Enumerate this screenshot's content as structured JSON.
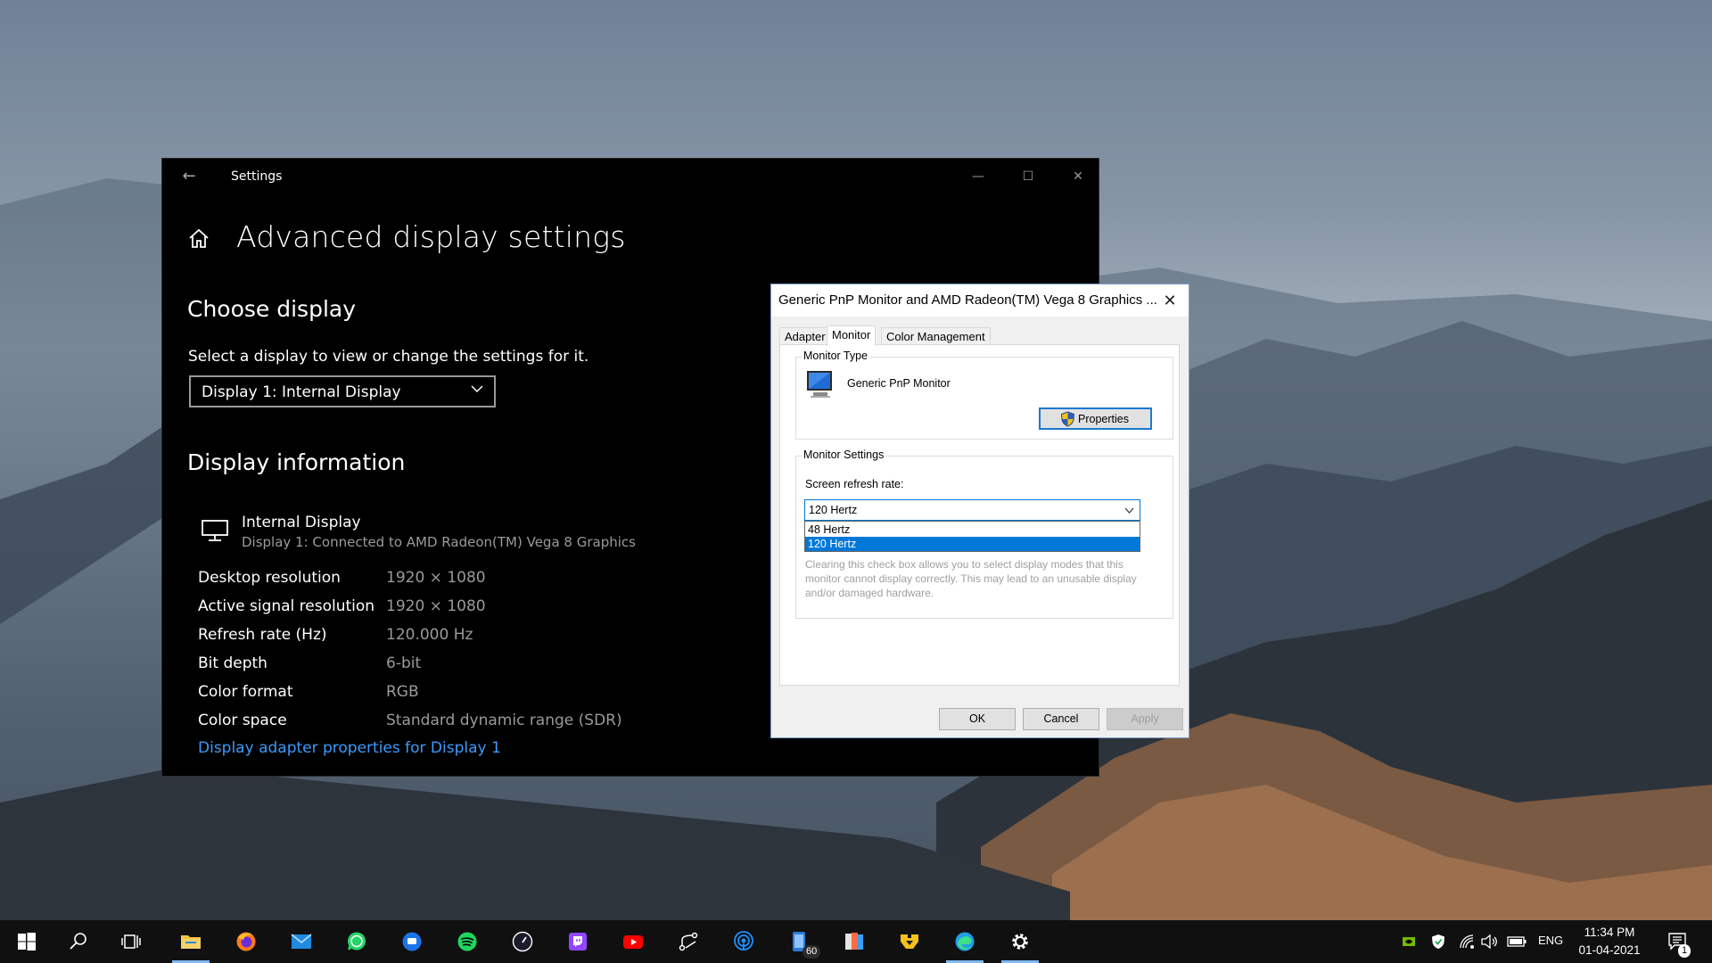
{
  "settings": {
    "app_title": "Settings",
    "page_title": "Advanced display settings",
    "choose_display_heading": "Choose display",
    "select_description": "Select a display to view or change the settings for it.",
    "display_dropdown_value": "Display 1: Internal Display",
    "display_info_heading": "Display information",
    "internal_display_name": "Internal Display",
    "internal_display_sub": "Display 1: Connected to AMD Radeon(TM) Vega 8 Graphics",
    "info_rows": [
      {
        "key": "Desktop resolution",
        "value": "1920 × 1080"
      },
      {
        "key": "Active signal resolution",
        "value": "1920 × 1080"
      },
      {
        "key": "Refresh rate (Hz)",
        "value": "120.000 Hz"
      },
      {
        "key": "Bit depth",
        "value": "6-bit"
      },
      {
        "key": "Color format",
        "value": "RGB"
      },
      {
        "key": "Color space",
        "value": "Standard dynamic range (SDR)"
      }
    ],
    "adapter_link": "Display adapter properties for Display 1"
  },
  "dialog": {
    "title": "Generic PnP Monitor and AMD Radeon(TM) Vega 8 Graphics ...",
    "tabs": [
      "Adapter",
      "Monitor",
      "Color Management"
    ],
    "active_tab": "Monitor",
    "monitor_type_legend": "Monitor Type",
    "monitor_name": "Generic PnP Monitor",
    "properties_button": "Properties",
    "monitor_settings_legend": "Monitor Settings",
    "refresh_rate_label": "Screen refresh rate:",
    "refresh_rate_selected": "120 Hertz",
    "refresh_rate_options": [
      "48 Hertz",
      "120 Hertz"
    ],
    "warning_text": "Clearing this check box allows you to select display modes that this monitor cannot display correctly. This may lead to an unusable display and/or damaged hardware.",
    "ok_button": "OK",
    "cancel_button": "Cancel",
    "apply_button": "Apply"
  },
  "taskbar": {
    "apps": [
      "start",
      "search",
      "task-view",
      "file-explorer",
      "firefox",
      "mail",
      "whatsapp",
      "messages",
      "spotify",
      "speedtest",
      "twitch",
      "youtube",
      "git-app",
      "podcasts",
      "phone-app",
      "office-app",
      "app-yellow",
      "edge",
      "settings"
    ],
    "phone_badge": "60",
    "language": "ENG",
    "time": "11:34 PM",
    "date": "01-04-2021",
    "notification_count": "1"
  },
  "colors": {
    "accent": "#0078d7",
    "link": "#3a9bfc",
    "settings_bg": "#000000",
    "dialog_bg": "#f0f0f0"
  }
}
